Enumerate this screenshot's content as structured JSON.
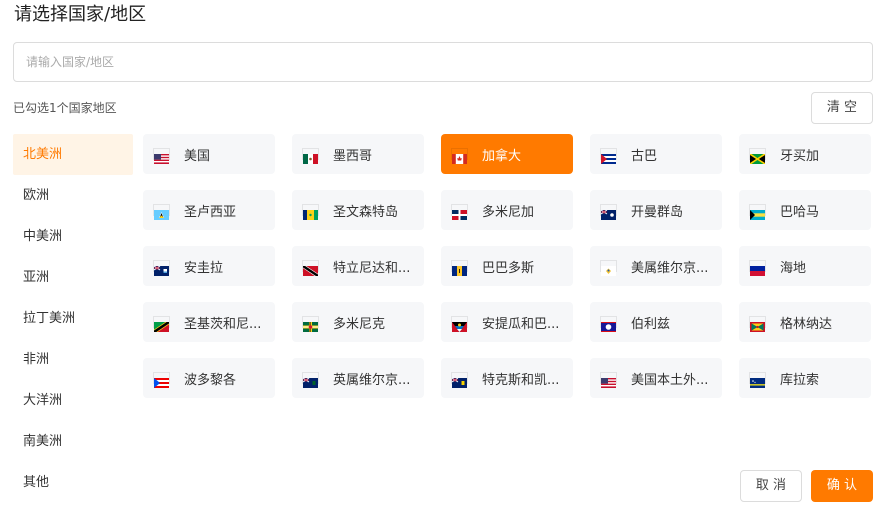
{
  "dialog": {
    "title": "请选择国家/地区",
    "search_placeholder": "请输入国家/地区",
    "selected_text": "已勾选1个国家地区",
    "clear_label": "清 空",
    "cancel_label": "取 消",
    "confirm_label": "确 认",
    "accent_color": "#ff7a00"
  },
  "sidebar": {
    "items": [
      {
        "label": "北美洲",
        "active": true
      },
      {
        "label": "欧洲",
        "active": false
      },
      {
        "label": "中美洲",
        "active": false
      },
      {
        "label": "亚洲",
        "active": false
      },
      {
        "label": "拉丁美洲",
        "active": false
      },
      {
        "label": "非洲",
        "active": false
      },
      {
        "label": "大洋洲",
        "active": false
      },
      {
        "label": "南美洲",
        "active": false
      },
      {
        "label": "其他",
        "active": false
      }
    ]
  },
  "countries": [
    {
      "label": "美国",
      "flag": "us-flag-icon",
      "selected": false
    },
    {
      "label": "墨西哥",
      "flag": "mexico-flag-icon",
      "selected": false
    },
    {
      "label": "加拿大",
      "flag": "canada-flag-icon",
      "selected": true
    },
    {
      "label": "古巴",
      "flag": "cuba-flag-icon",
      "selected": false
    },
    {
      "label": "牙买加",
      "flag": "jamaica-flag-icon",
      "selected": false
    },
    {
      "label": "圣卢西亚",
      "flag": "saint-lucia-flag-icon",
      "selected": false
    },
    {
      "label": "圣文森特岛",
      "flag": "saint-vincent-flag-icon",
      "selected": false
    },
    {
      "label": "多米尼加",
      "flag": "dominican-republic-flag-icon",
      "selected": false
    },
    {
      "label": "开曼群岛",
      "flag": "cayman-islands-flag-icon",
      "selected": false
    },
    {
      "label": "巴哈马",
      "flag": "bahamas-flag-icon",
      "selected": false
    },
    {
      "label": "安圭拉",
      "flag": "anguilla-flag-icon",
      "selected": false
    },
    {
      "label": "特立尼达和...",
      "flag": "trinidad-flag-icon",
      "selected": false
    },
    {
      "label": "巴巴多斯",
      "flag": "barbados-flag-icon",
      "selected": false
    },
    {
      "label": "美属维尔京...",
      "flag": "us-virgin-islands-flag-icon",
      "selected": false
    },
    {
      "label": "海地",
      "flag": "haiti-flag-icon",
      "selected": false
    },
    {
      "label": "圣基茨和尼...",
      "flag": "saint-kitts-flag-icon",
      "selected": false
    },
    {
      "label": "多米尼克",
      "flag": "dominica-flag-icon",
      "selected": false
    },
    {
      "label": "安提瓜和巴...",
      "flag": "antigua-flag-icon",
      "selected": false
    },
    {
      "label": "伯利兹",
      "flag": "belize-flag-icon",
      "selected": false
    },
    {
      "label": "格林纳达",
      "flag": "grenada-flag-icon",
      "selected": false
    },
    {
      "label": "波多黎各",
      "flag": "puerto-rico-flag-icon",
      "selected": false
    },
    {
      "label": "英属维尔京...",
      "flag": "british-virgin-islands-flag-icon",
      "selected": false
    },
    {
      "label": "特克斯和凯...",
      "flag": "turks-caicos-flag-icon",
      "selected": false
    },
    {
      "label": "美国本土外...",
      "flag": "us-minor-islands-flag-icon",
      "selected": false
    },
    {
      "label": "库拉索",
      "flag": "curacao-flag-icon",
      "selected": false
    }
  ]
}
